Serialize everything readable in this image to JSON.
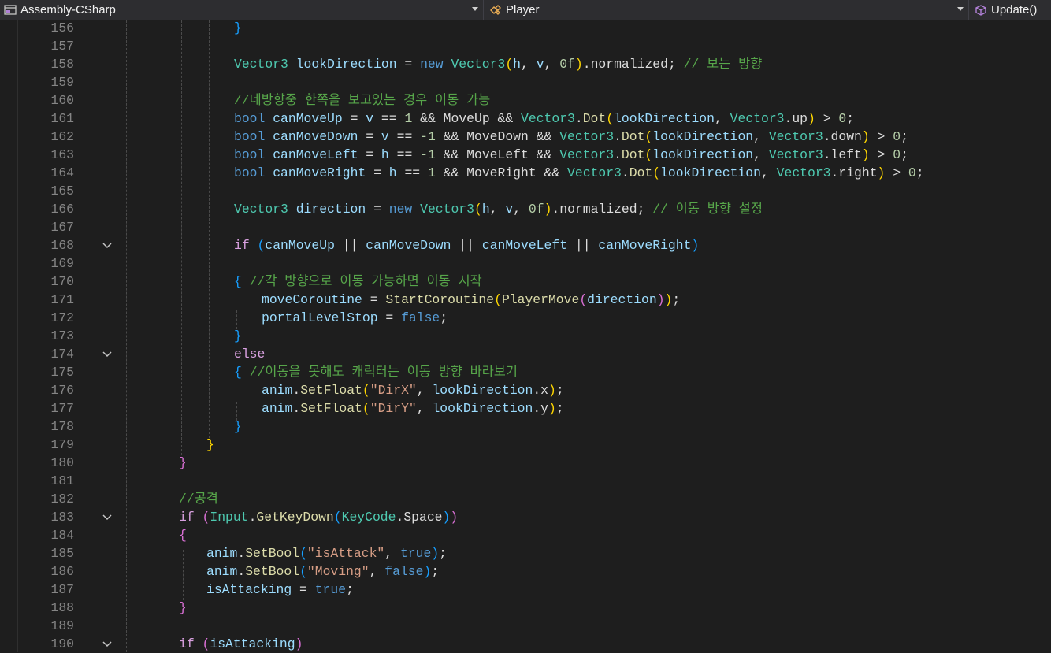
{
  "navbar": {
    "project": "Assembly-CSharp",
    "class": "Player",
    "method": "Update()"
  },
  "editor": {
    "lines": [
      {
        "n": "156",
        "fold": false,
        "indent": 10,
        "tokens": [
          [
            "}",
            "br3"
          ]
        ]
      },
      {
        "n": "157",
        "fold": false,
        "indent": 0,
        "tokens": []
      },
      {
        "n": "158",
        "fold": false,
        "indent": 10,
        "tokens": [
          [
            "Vector3",
            "ty"
          ],
          [
            " ",
            "pl"
          ],
          [
            "lookDirection",
            "var"
          ],
          [
            " = ",
            "pl"
          ],
          [
            "new",
            "kw"
          ],
          [
            " ",
            "pl"
          ],
          [
            "Vector3",
            "ty"
          ],
          [
            "(",
            "br1"
          ],
          [
            "h",
            "var"
          ],
          [
            ", ",
            "pl"
          ],
          [
            "v",
            "var"
          ],
          [
            ", ",
            "pl"
          ],
          [
            "0f",
            "num"
          ],
          [
            ")",
            "br1"
          ],
          [
            ".normalized; ",
            "pl"
          ],
          [
            "// 보는 방향",
            "cm"
          ]
        ]
      },
      {
        "n": "159",
        "fold": false,
        "indent": 0,
        "tokens": []
      },
      {
        "n": "160",
        "fold": false,
        "indent": 10,
        "tokens": [
          [
            "//네방향중 한쪽을 보고있는 경우 이동 가능",
            "cm"
          ]
        ]
      },
      {
        "n": "161",
        "fold": false,
        "indent": 10,
        "tokens": [
          [
            "bool",
            "kw"
          ],
          [
            " ",
            "pl"
          ],
          [
            "canMoveUp",
            "var"
          ],
          [
            " = ",
            "pl"
          ],
          [
            "v",
            "var"
          ],
          [
            " == ",
            "pl"
          ],
          [
            "1",
            "num"
          ],
          [
            " && MoveUp && ",
            "pl"
          ],
          [
            "Vector3",
            "ty"
          ],
          [
            ".",
            "pl"
          ],
          [
            "Dot",
            "fn"
          ],
          [
            "(",
            "br1"
          ],
          [
            "lookDirection",
            "var"
          ],
          [
            ", ",
            "pl"
          ],
          [
            "Vector3",
            "ty"
          ],
          [
            ".up",
            "pl"
          ],
          [
            ")",
            "br1"
          ],
          [
            " > ",
            "pl"
          ],
          [
            "0",
            "num"
          ],
          [
            ";",
            "pl"
          ]
        ]
      },
      {
        "n": "162",
        "fold": false,
        "indent": 10,
        "tokens": [
          [
            "bool",
            "kw"
          ],
          [
            " ",
            "pl"
          ],
          [
            "canMoveDown",
            "var"
          ],
          [
            " = ",
            "pl"
          ],
          [
            "v",
            "var"
          ],
          [
            " == ",
            "pl"
          ],
          [
            "-1",
            "num"
          ],
          [
            " && MoveDown && ",
            "pl"
          ],
          [
            "Vector3",
            "ty"
          ],
          [
            ".",
            "pl"
          ],
          [
            "Dot",
            "fn"
          ],
          [
            "(",
            "br1"
          ],
          [
            "lookDirection",
            "var"
          ],
          [
            ", ",
            "pl"
          ],
          [
            "Vector3",
            "ty"
          ],
          [
            ".down",
            "pl"
          ],
          [
            ")",
            "br1"
          ],
          [
            " > ",
            "pl"
          ],
          [
            "0",
            "num"
          ],
          [
            ";",
            "pl"
          ]
        ]
      },
      {
        "n": "163",
        "fold": false,
        "indent": 10,
        "tokens": [
          [
            "bool",
            "kw"
          ],
          [
            " ",
            "pl"
          ],
          [
            "canMoveLeft",
            "var"
          ],
          [
            " = ",
            "pl"
          ],
          [
            "h",
            "var"
          ],
          [
            " == ",
            "pl"
          ],
          [
            "-1",
            "num"
          ],
          [
            " && MoveLeft && ",
            "pl"
          ],
          [
            "Vector3",
            "ty"
          ],
          [
            ".",
            "pl"
          ],
          [
            "Dot",
            "fn"
          ],
          [
            "(",
            "br1"
          ],
          [
            "lookDirection",
            "var"
          ],
          [
            ", ",
            "pl"
          ],
          [
            "Vector3",
            "ty"
          ],
          [
            ".left",
            "pl"
          ],
          [
            ")",
            "br1"
          ],
          [
            " > ",
            "pl"
          ],
          [
            "0",
            "num"
          ],
          [
            ";",
            "pl"
          ]
        ]
      },
      {
        "n": "164",
        "fold": false,
        "indent": 10,
        "tokens": [
          [
            "bool",
            "kw"
          ],
          [
            " ",
            "pl"
          ],
          [
            "canMoveRight",
            "var"
          ],
          [
            " = ",
            "pl"
          ],
          [
            "h",
            "var"
          ],
          [
            " == ",
            "pl"
          ],
          [
            "1",
            "num"
          ],
          [
            " && MoveRight && ",
            "pl"
          ],
          [
            "Vector3",
            "ty"
          ],
          [
            ".",
            "pl"
          ],
          [
            "Dot",
            "fn"
          ],
          [
            "(",
            "br1"
          ],
          [
            "lookDirection",
            "var"
          ],
          [
            ", ",
            "pl"
          ],
          [
            "Vector3",
            "ty"
          ],
          [
            ".right",
            "pl"
          ],
          [
            ")",
            "br1"
          ],
          [
            " > ",
            "pl"
          ],
          [
            "0",
            "num"
          ],
          [
            ";",
            "pl"
          ]
        ]
      },
      {
        "n": "165",
        "fold": false,
        "indent": 0,
        "tokens": []
      },
      {
        "n": "166",
        "fold": false,
        "indent": 10,
        "tokens": [
          [
            "Vector3",
            "ty"
          ],
          [
            " ",
            "pl"
          ],
          [
            "direction",
            "var"
          ],
          [
            " = ",
            "pl"
          ],
          [
            "new",
            "kw"
          ],
          [
            " ",
            "pl"
          ],
          [
            "Vector3",
            "ty"
          ],
          [
            "(",
            "br1"
          ],
          [
            "h",
            "var"
          ],
          [
            ", ",
            "pl"
          ],
          [
            "v",
            "var"
          ],
          [
            ", ",
            "pl"
          ],
          [
            "0f",
            "num"
          ],
          [
            ")",
            "br1"
          ],
          [
            ".normalized; ",
            "pl"
          ],
          [
            "// 이동 방향 설정",
            "cm"
          ]
        ]
      },
      {
        "n": "167",
        "fold": false,
        "indent": 0,
        "tokens": []
      },
      {
        "n": "168",
        "fold": true,
        "indent": 10,
        "tokens": [
          [
            "if",
            "ctl"
          ],
          [
            " ",
            "pl"
          ],
          [
            "(",
            "br3"
          ],
          [
            "canMoveUp",
            "var"
          ],
          [
            " || ",
            "pl"
          ],
          [
            "canMoveDown",
            "var"
          ],
          [
            " || ",
            "pl"
          ],
          [
            "canMoveLeft",
            "var"
          ],
          [
            " || ",
            "pl"
          ],
          [
            "canMoveRight",
            "var"
          ],
          [
            ")",
            "br3"
          ]
        ]
      },
      {
        "n": "169",
        "fold": false,
        "indent": 0,
        "tokens": []
      },
      {
        "n": "170",
        "fold": false,
        "indent": 10,
        "tokens": [
          [
            "{",
            "br3"
          ],
          [
            " ",
            "pl"
          ],
          [
            "//각 방향으로 이동 가능하면 이동 시작",
            "cm"
          ]
        ]
      },
      {
        "n": "171",
        "fold": false,
        "indent": 14,
        "tokens": [
          [
            "moveCoroutine",
            "var"
          ],
          [
            " = ",
            "pl"
          ],
          [
            "StartCoroutine",
            "fn"
          ],
          [
            "(",
            "br1"
          ],
          [
            "PlayerMove",
            "fn"
          ],
          [
            "(",
            "br2"
          ],
          [
            "direction",
            "var"
          ],
          [
            ")",
            "br2"
          ],
          [
            ")",
            "br1"
          ],
          [
            ";",
            "pl"
          ]
        ]
      },
      {
        "n": "172",
        "fold": false,
        "indent": 14,
        "tokens": [
          [
            "portalLevelStop",
            "var"
          ],
          [
            " = ",
            "pl"
          ],
          [
            "false",
            "kw"
          ],
          [
            ";",
            "pl"
          ]
        ]
      },
      {
        "n": "173",
        "fold": false,
        "indent": 10,
        "tokens": [
          [
            "}",
            "br3"
          ]
        ]
      },
      {
        "n": "174",
        "fold": true,
        "indent": 10,
        "tokens": [
          [
            "else",
            "ctl"
          ]
        ]
      },
      {
        "n": "175",
        "fold": false,
        "indent": 10,
        "tokens": [
          [
            "{",
            "br3"
          ],
          [
            " ",
            "pl"
          ],
          [
            "//이동을 못해도 캐릭터는 이동 방향 바라보기",
            "cm"
          ]
        ]
      },
      {
        "n": "176",
        "fold": false,
        "indent": 14,
        "tokens": [
          [
            "anim",
            "var"
          ],
          [
            ".",
            "pl"
          ],
          [
            "SetFloat",
            "fn"
          ],
          [
            "(",
            "br1"
          ],
          [
            "\"DirX\"",
            "str"
          ],
          [
            ", ",
            "pl"
          ],
          [
            "lookDirection",
            "var"
          ],
          [
            ".x",
            "pl"
          ],
          [
            ")",
            "br1"
          ],
          [
            ";",
            "pl"
          ]
        ]
      },
      {
        "n": "177",
        "fold": false,
        "indent": 14,
        "tokens": [
          [
            "anim",
            "var"
          ],
          [
            ".",
            "pl"
          ],
          [
            "SetFloat",
            "fn"
          ],
          [
            "(",
            "br1"
          ],
          [
            "\"DirY\"",
            "str"
          ],
          [
            ", ",
            "pl"
          ],
          [
            "lookDirection",
            "var"
          ],
          [
            ".y",
            "pl"
          ],
          [
            ")",
            "br1"
          ],
          [
            ";",
            "pl"
          ]
        ]
      },
      {
        "n": "178",
        "fold": false,
        "indent": 10,
        "tokens": [
          [
            "}",
            "br3"
          ]
        ]
      },
      {
        "n": "179",
        "fold": false,
        "indent": 6,
        "tokens": [
          [
            "}",
            "br1"
          ]
        ]
      },
      {
        "n": "180",
        "fold": false,
        "indent": 2,
        "tokens": [
          [
            "}",
            "br2"
          ]
        ]
      },
      {
        "n": "181",
        "fold": false,
        "indent": 0,
        "tokens": []
      },
      {
        "n": "182",
        "fold": false,
        "indent": 2,
        "tokens": [
          [
            "//공격",
            "cm"
          ]
        ]
      },
      {
        "n": "183",
        "fold": true,
        "indent": 2,
        "tokens": [
          [
            "if",
            "ctl"
          ],
          [
            " ",
            "pl"
          ],
          [
            "(",
            "br2"
          ],
          [
            "Input",
            "ty"
          ],
          [
            ".",
            "pl"
          ],
          [
            "GetKeyDown",
            "fn"
          ],
          [
            "(",
            "br3"
          ],
          [
            "KeyCode",
            "ty"
          ],
          [
            ".Space",
            "pl"
          ],
          [
            ")",
            "br3"
          ],
          [
            ")",
            "br2"
          ]
        ]
      },
      {
        "n": "184",
        "fold": false,
        "indent": 2,
        "tokens": [
          [
            "{",
            "br2"
          ]
        ]
      },
      {
        "n": "185",
        "fold": false,
        "indent": 6,
        "tokens": [
          [
            "anim",
            "var"
          ],
          [
            ".",
            "pl"
          ],
          [
            "SetBool",
            "fn"
          ],
          [
            "(",
            "br3"
          ],
          [
            "\"isAttack\"",
            "str"
          ],
          [
            ", ",
            "pl"
          ],
          [
            "true",
            "kw"
          ],
          [
            ")",
            "br3"
          ],
          [
            ";",
            "pl"
          ]
        ]
      },
      {
        "n": "186",
        "fold": false,
        "indent": 6,
        "tokens": [
          [
            "anim",
            "var"
          ],
          [
            ".",
            "pl"
          ],
          [
            "SetBool",
            "fn"
          ],
          [
            "(",
            "br3"
          ],
          [
            "\"Moving\"",
            "str"
          ],
          [
            ", ",
            "pl"
          ],
          [
            "false",
            "kw"
          ],
          [
            ")",
            "br3"
          ],
          [
            ";",
            "pl"
          ]
        ]
      },
      {
        "n": "187",
        "fold": false,
        "indent": 6,
        "tokens": [
          [
            "isAttacking",
            "var"
          ],
          [
            " = ",
            "pl"
          ],
          [
            "true",
            "kw"
          ],
          [
            ";",
            "pl"
          ]
        ]
      },
      {
        "n": "188",
        "fold": false,
        "indent": 2,
        "tokens": [
          [
            "}",
            "br2"
          ]
        ]
      },
      {
        "n": "189",
        "fold": false,
        "indent": 0,
        "tokens": []
      },
      {
        "n": "190",
        "fold": true,
        "indent": 2,
        "tokens": [
          [
            "if",
            "ctl"
          ],
          [
            " ",
            "pl"
          ],
          [
            "(",
            "br2"
          ],
          [
            "isAttacking",
            "var"
          ],
          [
            ")",
            "br2"
          ]
        ]
      }
    ]
  }
}
